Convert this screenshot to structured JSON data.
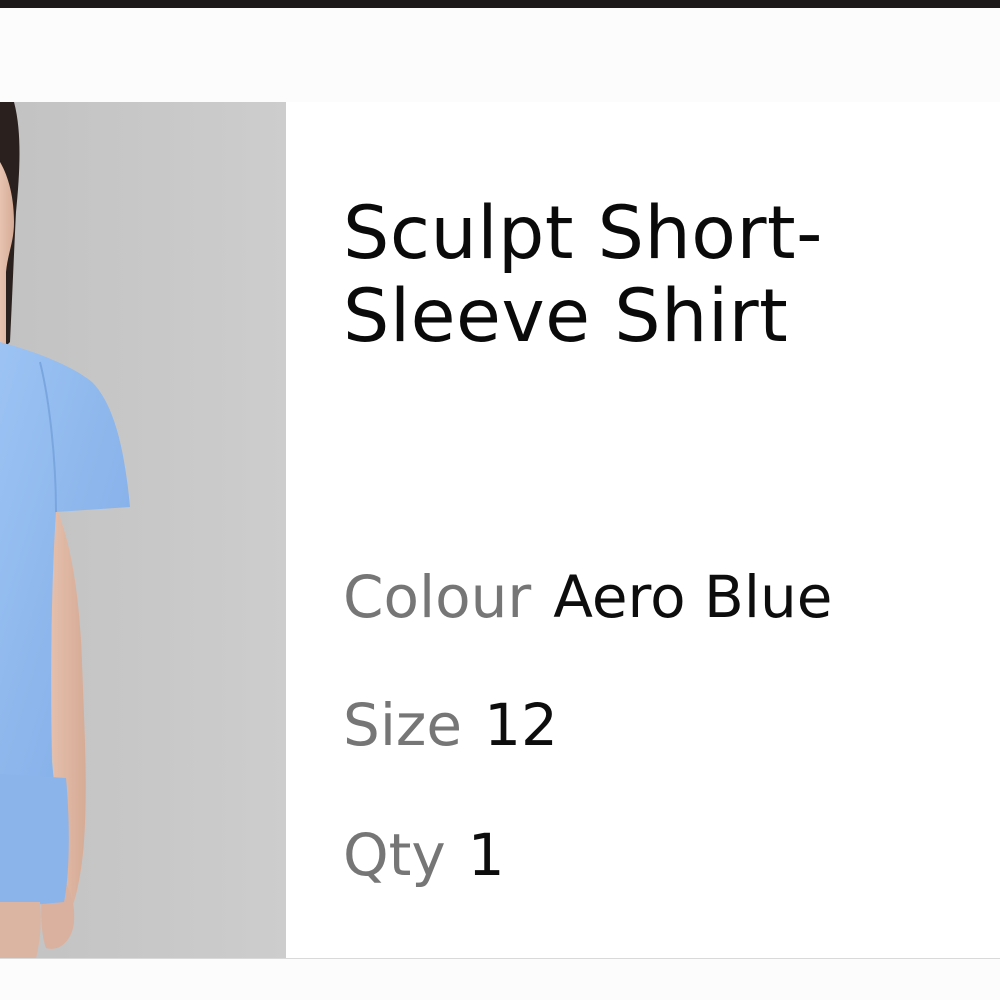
{
  "product": {
    "title_line1": "Sculpt Short-",
    "title_line2": "Sleeve Shirt",
    "image_alt": "Model wearing Sculpt Short-Sleeve Shirt in Aero Blue"
  },
  "attributes": [
    {
      "label": "Colour",
      "value": "Aero Blue"
    },
    {
      "label": "Size",
      "value": "12"
    },
    {
      "label": "Qty",
      "value": "1"
    }
  ],
  "colors": {
    "shirt": "#8fb8ee",
    "photo_background": "#c9c9c9",
    "label": "#767676",
    "text": "#0a0a0a",
    "top_bar": "#1d191b"
  }
}
